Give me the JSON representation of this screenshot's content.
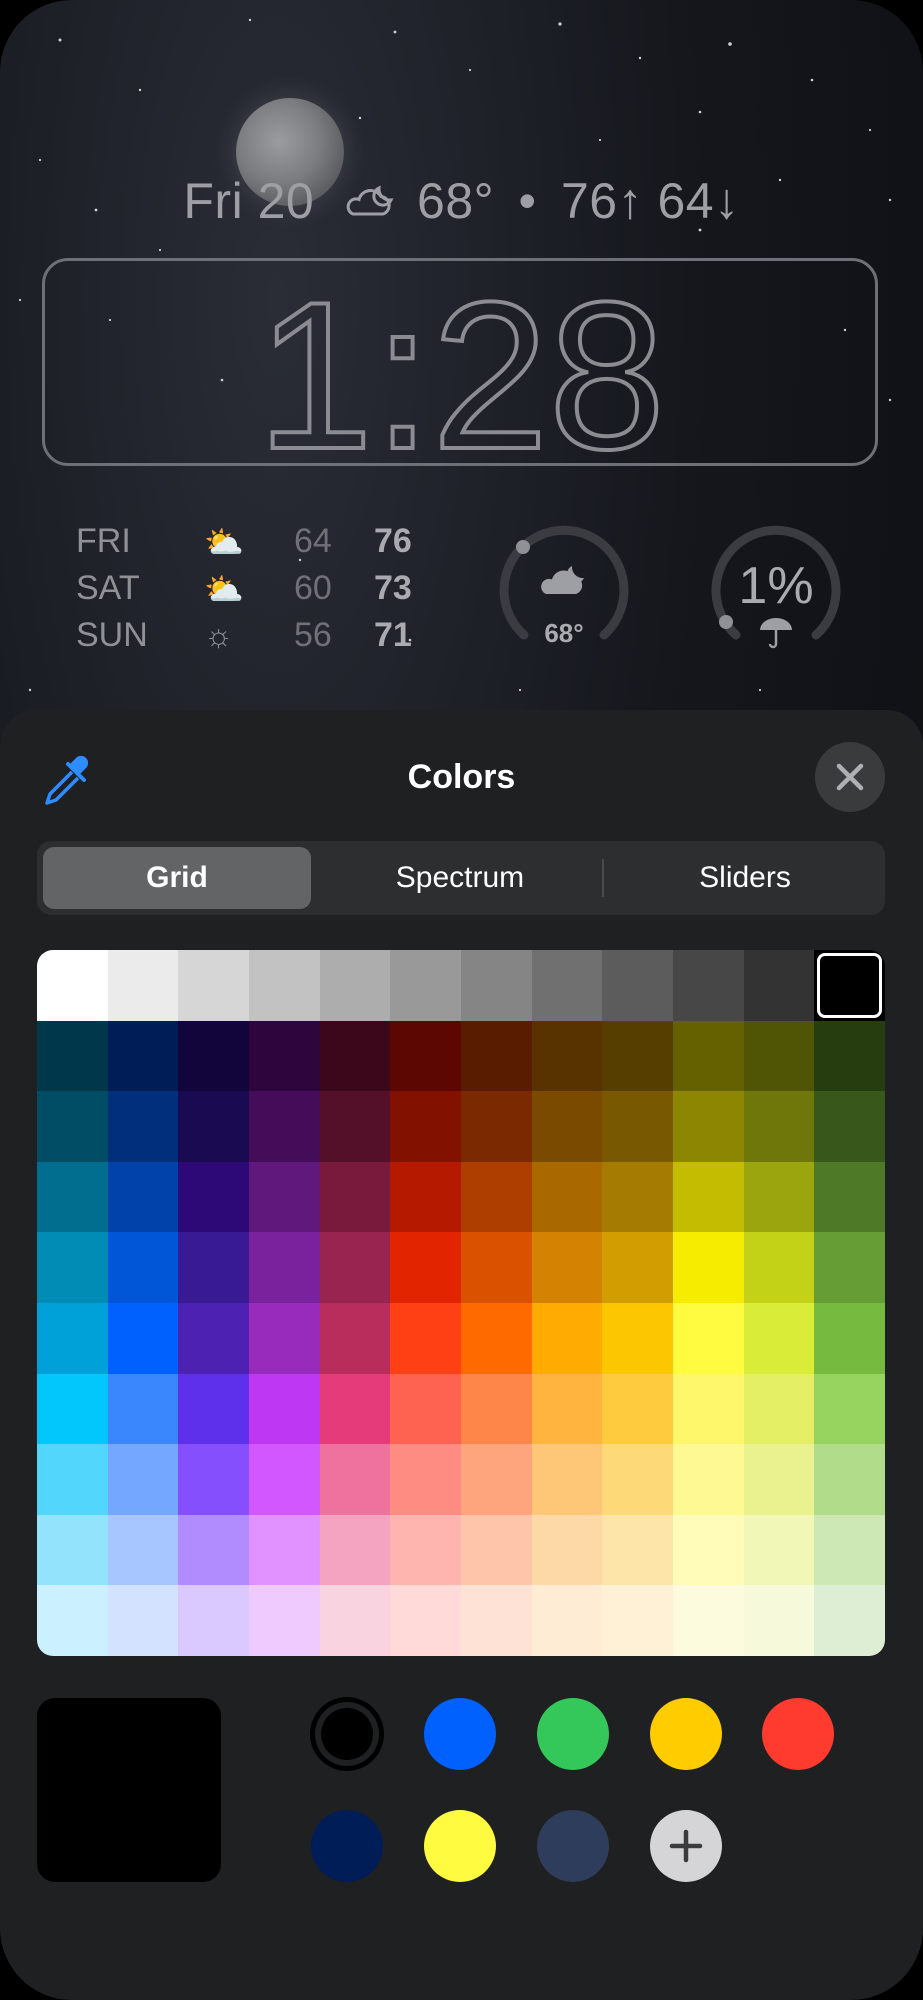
{
  "lockscreen": {
    "date": "Fri 20",
    "current_temp": "68°",
    "separator": "•",
    "hi_lo": "76↑ 64↓",
    "time": "1:28",
    "forecast": [
      {
        "day": "FRI",
        "icon": "partly-cloudy-sun-icon",
        "low": "64",
        "high": "76"
      },
      {
        "day": "SAT",
        "icon": "partly-cloudy-sun-icon",
        "low": "60",
        "high": "73"
      },
      {
        "day": "SUN",
        "icon": "sun-icon",
        "low": "56",
        "high": "71"
      }
    ],
    "temp_gauge": {
      "value": "68°",
      "icon": "cloud-moon-icon"
    },
    "rain_gauge": {
      "value": "1%",
      "icon": "umbrella-icon"
    }
  },
  "sheet": {
    "title": "Colors",
    "eyedropper_icon": "eyedropper-icon",
    "close_icon": "close-icon",
    "tabs": [
      "Grid",
      "Spectrum",
      "Sliders"
    ],
    "selected_tab": "Grid",
    "selected_color": "#000000",
    "grid_rows": [
      [
        "#ffffff",
        "#ebebeb",
        "#d6d6d6",
        "#c2c2c2",
        "#adadad",
        "#999999",
        "#858585",
        "#707070",
        "#5c5c5c",
        "#474747",
        "#333333",
        "#000000"
      ],
      [
        "#00374a",
        "#011d57",
        "#11053b",
        "#2e063d",
        "#3c071b",
        "#5c0701",
        "#5a1c00",
        "#583300",
        "#563d00",
        "#666100",
        "#4f5504",
        "#263e0f"
      ],
      [
        "#004d65",
        "#012f7b",
        "#1a0a52",
        "#450d59",
        "#551029",
        "#831100",
        "#7b2900",
        "#7a4a00",
        "#785800",
        "#8d8602",
        "#6f760a",
        "#38571a"
      ],
      [
        "#016e8f",
        "#0042a9",
        "#2c0977",
        "#61187c",
        "#791a3d",
        "#b51a00",
        "#ad3e00",
        "#a96800",
        "#a67b01",
        "#c4bc00",
        "#9ba50e",
        "#4e7a27"
      ],
      [
        "#008cb4",
        "#0056d6",
        "#371a94",
        "#7a219e",
        "#99244f",
        "#e22400",
        "#da5100",
        "#d38301",
        "#d19d01",
        "#f5ec00",
        "#c3d117",
        "#669d34"
      ],
      [
        "#00a1d8",
        "#0061fe",
        "#4d22b2",
        "#982abc",
        "#b92d5d",
        "#ff4015",
        "#ff6a00",
        "#ffab01",
        "#fcc700",
        "#fefb41",
        "#d9ec37",
        "#76bb40"
      ],
      [
        "#01c7fc",
        "#3a87fd",
        "#5e30eb",
        "#be38f3",
        "#e63b7a",
        "#fe6250",
        "#fe8648",
        "#feb43f",
        "#fecb3e",
        "#fff76b",
        "#e4ef65",
        "#96d35f"
      ],
      [
        "#52d6fc",
        "#74a7ff",
        "#864ffd",
        "#d357fe",
        "#ee719e",
        "#ff8c82",
        "#fea57d",
        "#fec777",
        "#fed977",
        "#fff994",
        "#eaf28f",
        "#b1dd8b"
      ],
      [
        "#93e3fc",
        "#a7c6ff",
        "#b18cfe",
        "#e292fe",
        "#f4a4c0",
        "#ffb5af",
        "#ffc5ab",
        "#fed9a8",
        "#fde4a8",
        "#fffbb9",
        "#f1f7b7",
        "#cde8b5"
      ],
      [
        "#cbf0ff",
        "#d3e2ff",
        "#d9c9fe",
        "#efcaff",
        "#f9d3e0",
        "#ffdad8",
        "#ffe2d6",
        "#feecd4",
        "#fef1d5",
        "#fdfbdd",
        "#f6fadb",
        "#deeed4"
      ]
    ],
    "swatches": [
      {
        "name": "black-swatch",
        "color": "#000000",
        "selected": true
      },
      {
        "name": "blue-swatch",
        "color": "#0061fe",
        "selected": false
      },
      {
        "name": "green-swatch",
        "color": "#34c759",
        "selected": false
      },
      {
        "name": "yellow-swatch",
        "color": "#ffcc00",
        "selected": false
      },
      {
        "name": "red-swatch",
        "color": "#ff3b30",
        "selected": false
      },
      {
        "name": "navy-swatch",
        "color": "#011d57",
        "selected": false
      },
      {
        "name": "bright-yellow-swatch",
        "color": "#fefb41",
        "selected": false
      },
      {
        "name": "slate-blue-swatch",
        "color": "#2f3d5c",
        "selected": false
      }
    ],
    "add_icon": "plus-icon"
  }
}
